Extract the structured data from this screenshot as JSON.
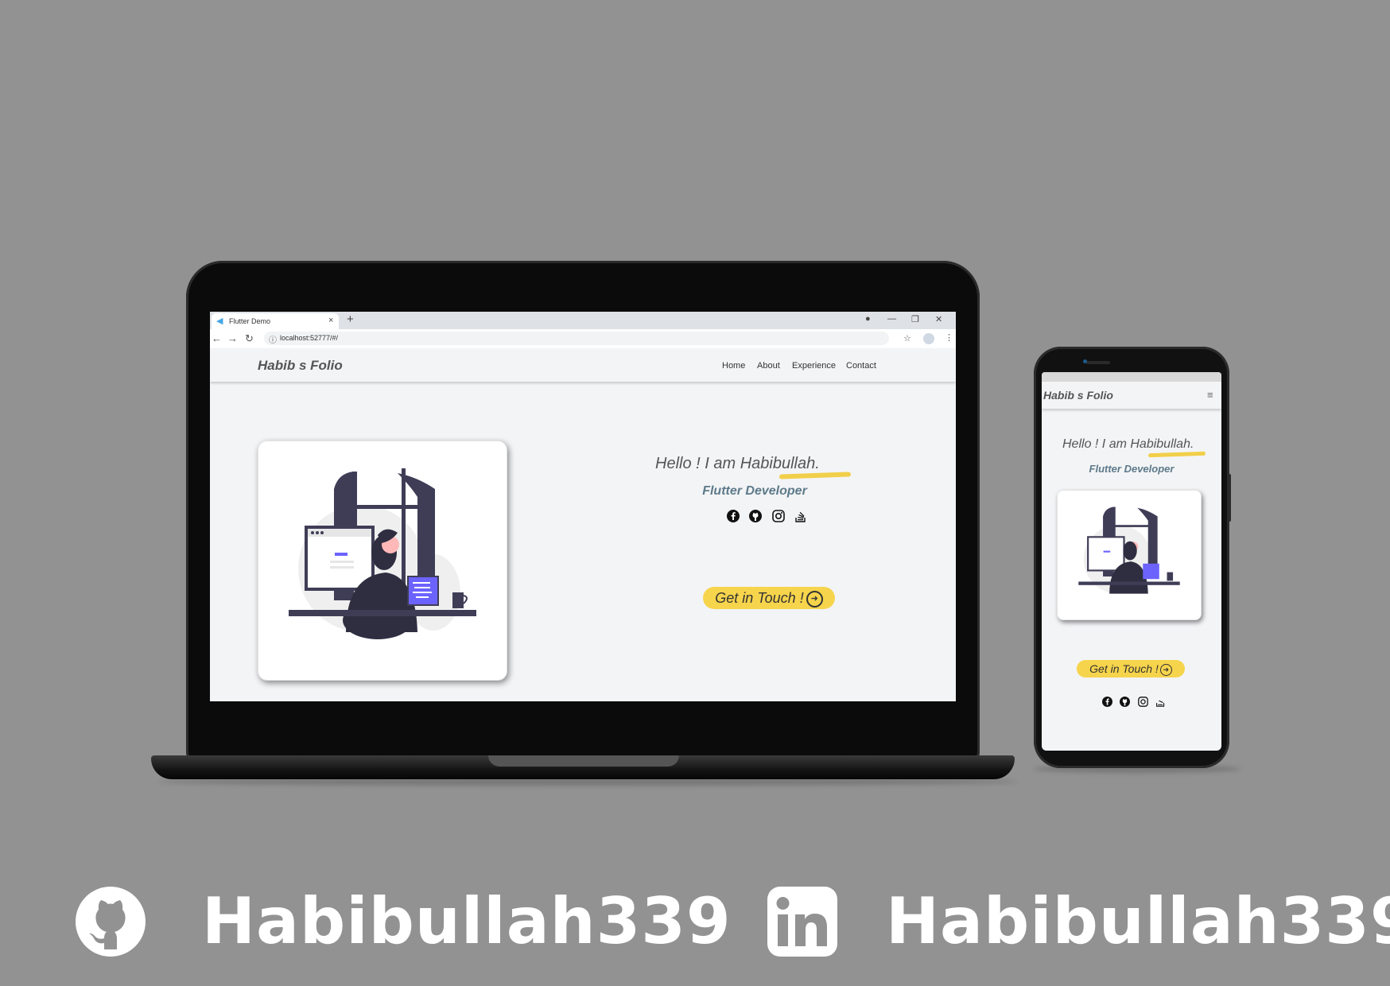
{
  "browser": {
    "tab_title": "Flutter Demo",
    "tab_close": "×",
    "new_tab": "+",
    "url": "localhost:52777/#/",
    "back": "←",
    "forward": "→",
    "reload": "↻",
    "window_minimize": "—",
    "window_maximize": "❐",
    "window_close": "✕"
  },
  "site": {
    "brand": "Habib s  Folio",
    "nav": [
      "Home",
      "About",
      "Experience",
      "Contact"
    ],
    "hello_prefix": "Hello !  I am ",
    "name": "Habibullah.",
    "role": "Flutter Developer",
    "cta": "Get in Touch !",
    "socials": [
      "facebook-icon",
      "github-icon",
      "instagram-icon",
      "stackoverflow-icon"
    ]
  },
  "phone": {
    "brand": "Habib s  Folio",
    "hello_prefix": "Hello !  I am ",
    "name": "Habibullah.",
    "role": "Flutter Developer",
    "cta": "Get in Touch !"
  },
  "footer": {
    "github_handle": "Habibullah339",
    "linkedin_handle": "Habibullah339"
  },
  "colors": {
    "background": "#929292",
    "accent_yellow": "#f6d44c",
    "role_text": "#5d7a8a"
  }
}
